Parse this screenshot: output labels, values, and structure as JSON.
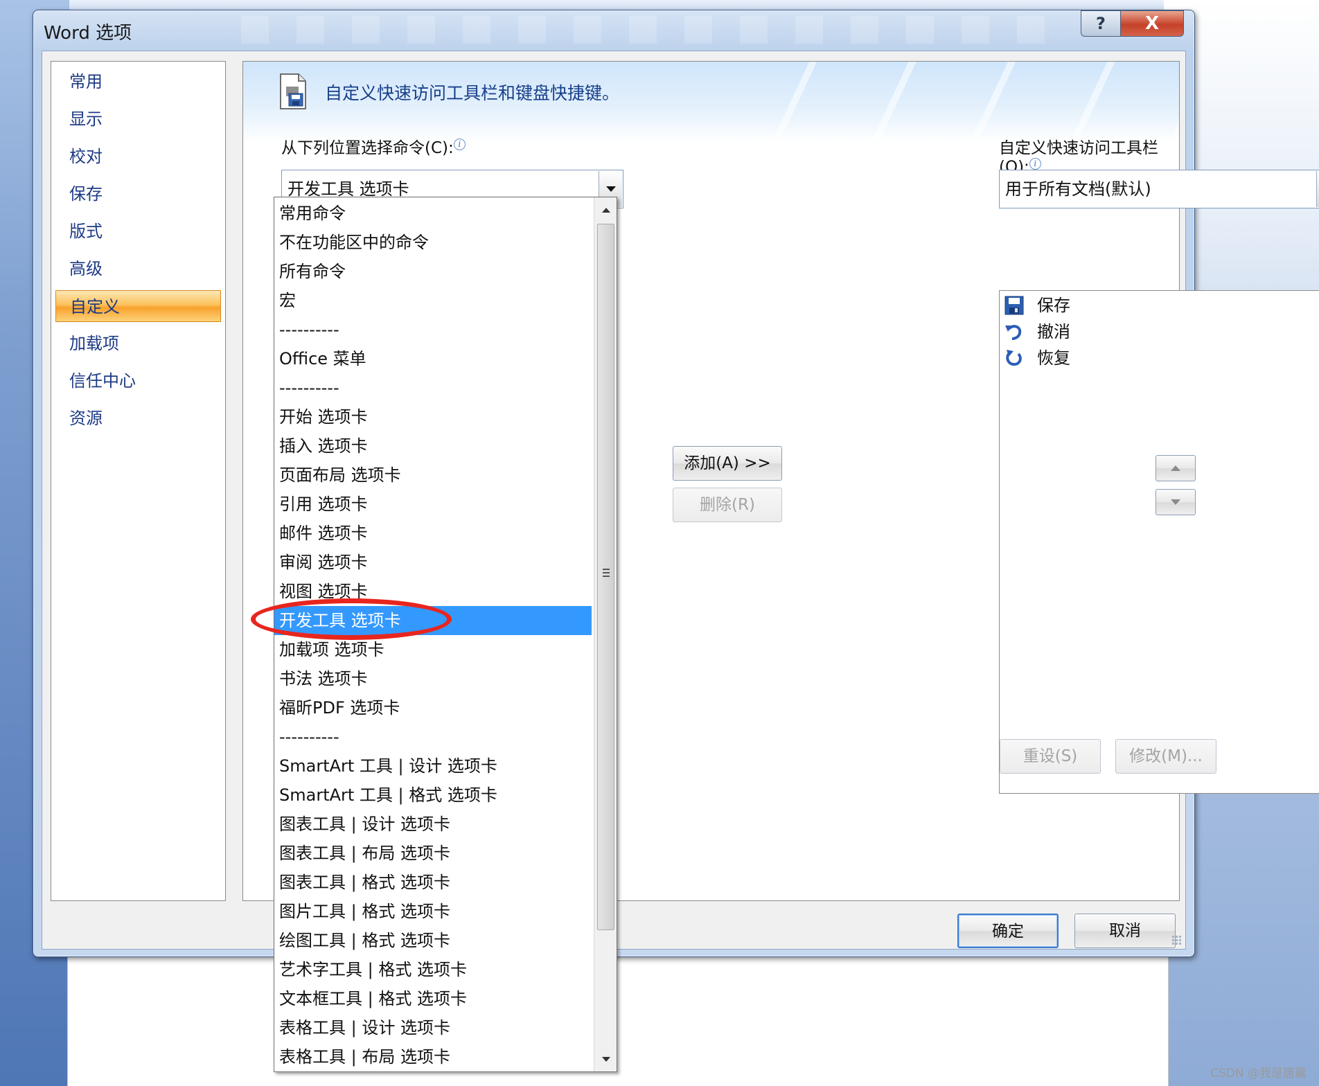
{
  "dialog": {
    "title": "Word 选项",
    "help_glyph": "?",
    "close_glyph": "X"
  },
  "nav": {
    "items": [
      {
        "label": "常用"
      },
      {
        "label": "显示"
      },
      {
        "label": "校对"
      },
      {
        "label": "保存"
      },
      {
        "label": "版式"
      },
      {
        "label": "高级"
      },
      {
        "label": "自定义",
        "selected": true
      },
      {
        "label": "加载项"
      },
      {
        "label": "信任中心"
      },
      {
        "label": "资源"
      }
    ]
  },
  "panel": {
    "header_text": "自定义快速访问工具栏和键盘快捷键。",
    "choose_label": "从下列位置选择命令(C):",
    "choose_value": "开发工具 选项卡",
    "qat_label": "自定义快速访问工具栏(Q):",
    "qat_value": "用于所有文档(默认)"
  },
  "dropdown": {
    "items": [
      "常用命令",
      "不在功能区中的命令",
      "所有命令",
      "宏",
      "----------",
      "Office 菜单",
      "----------",
      "开始 选项卡",
      "插入 选项卡",
      "页面布局 选项卡",
      "引用 选项卡",
      "邮件 选项卡",
      "审阅 选项卡",
      "视图 选项卡",
      "开发工具 选项卡",
      "加载项 选项卡",
      "书法 选项卡",
      "福昕PDF 选项卡",
      "----------",
      "SmartArt 工具 | 设计 选项卡",
      "SmartArt 工具 | 格式 选项卡",
      "图表工具 | 设计 选项卡",
      "图表工具 | 布局 选项卡",
      "图表工具 | 格式 选项卡",
      "图片工具 | 格式 选项卡",
      "绘图工具 | 格式 选项卡",
      "艺术字工具 | 格式 选项卡",
      "文本框工具 | 格式 选项卡",
      "表格工具 | 设计 选项卡",
      "表格工具 | 布局 选项卡"
    ],
    "selected": "开发工具 选项卡"
  },
  "qat_list": {
    "items": [
      {
        "label": "保存",
        "icon": "save-icon"
      },
      {
        "label": "撤消",
        "icon": "undo-icon"
      },
      {
        "label": "恢复",
        "icon": "redo-icon"
      }
    ]
  },
  "buttons": {
    "add": "添加(A) >>",
    "remove": "删除(R)",
    "reset": "重设(S)",
    "modify": "修改(M)...",
    "ok": "确定",
    "cancel": "取消"
  },
  "watermark": "CSDN @我是唐赢",
  "colors": {
    "selection": "#3399ff",
    "nav_active": "#fbc15c",
    "annotation": "#e8261e"
  }
}
